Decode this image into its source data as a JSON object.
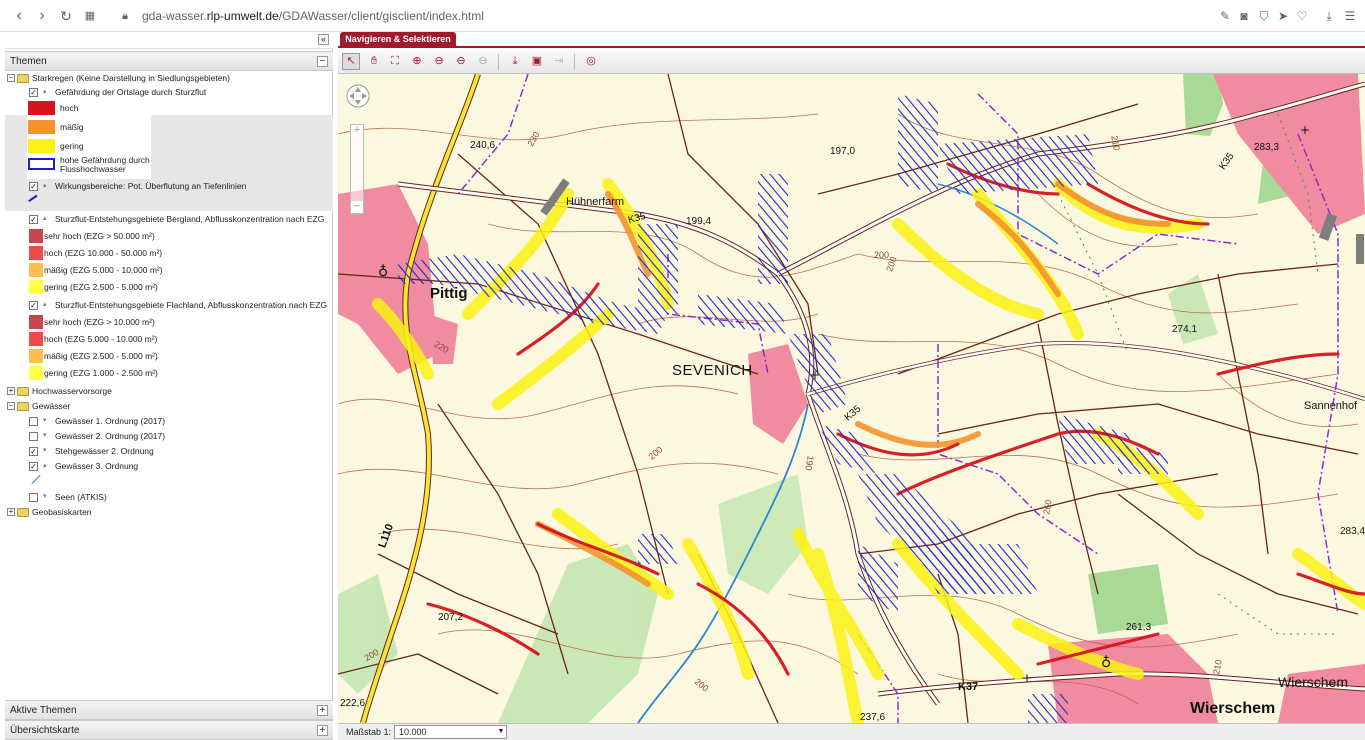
{
  "browser": {
    "url_prefix": "gda-wasser.",
    "url_host": "rlp-umwelt.de",
    "url_path": "/GDAWasser/client/gisclient/index.html"
  },
  "left_panel": {
    "themes_title": "Themen",
    "aktive_themen": "Aktive Themen",
    "uebersichtskarte": "Übersichtskarte",
    "tree": [
      {
        "label": "Starkregen (Keine Darstellung in Siedlungsgebieten)"
      },
      {
        "label": "Gefährdung der Ortslage durch Sturzflut"
      },
      {
        "label": "hoch",
        "color": "#d6141c"
      },
      {
        "label": "mäßig",
        "color": "#f5922e"
      },
      {
        "label": "gering",
        "color": "#fbf314"
      },
      {
        "label": "hohe Gefährdung durch",
        "label2": "Flusshochwasser",
        "color": "#1a1ad1"
      },
      {
        "label": "Wirkungsbereiche: Pot. Überflutung an Tiefenlinien"
      },
      {
        "label": "Sturzflut-Entstehungsgebiete Bergland, Abflusskonzentration nach EZG"
      },
      {
        "label": "sehr hoch (EZG > 50.000 m²)",
        "color": "#c9474a"
      },
      {
        "label": "hoch (EZG 10.000 - 50.000 m²)",
        "color": "#ee4b4b"
      },
      {
        "label": "mäßig (EZG 5.000 - 10.000 m²)",
        "color": "#ffbd4c"
      },
      {
        "label": "gering (EZG 2.500 - 5.000 m²)",
        "color": "#ffff44"
      },
      {
        "label": "Sturzflut-Entstehungsgebiete Flachland, Abflusskonzentration nach EZG"
      },
      {
        "label": "sehr hoch (EZG > 10.000 m²)",
        "color": "#c9474a"
      },
      {
        "label": "hoch (EZG 5.000 - 10.000 m²)",
        "color": "#ee4b4b"
      },
      {
        "label": "mäßig (EZG 2.500 - 5.000 m²)",
        "color": "#ffbd4c"
      },
      {
        "label": "gering (EZG 1.000 - 2.500 m²)",
        "color": "#ffff44"
      },
      {
        "label": "Hochwasservorsorge"
      },
      {
        "label": "Gewässer"
      },
      {
        "label": "Gewässer 1. Ordnung (2017)"
      },
      {
        "label": "Gewässer 2. Ordnung (2017)"
      },
      {
        "label": "Stehgewässer 2. Ordnung"
      },
      {
        "label": "Gewässer 3. Ordnung"
      },
      {
        "label": "Seen (ATKIS)"
      },
      {
        "label": "Geobasiskarten"
      }
    ]
  },
  "map": {
    "tab_label": "Navigieren & Selektieren",
    "labels": {
      "huehnerfarm": "Hühnerfarm",
      "k35_a": "K35",
      "k35_b": "K35",
      "k35_c": "K35",
      "k37": "K37",
      "l110": "L110",
      "sevenich": "SEVENICH",
      "pitting": "Pittig",
      "sannenhof": "Sannenhof",
      "wierschem": "Wierschem",
      "wierschem2": "Wierschem",
      "h240": "240,6",
      "h199": "199,4",
      "h197": "197,0",
      "h283a": "283,3",
      "h274": "274,1",
      "h283b": "283,4",
      "h261": "261,3",
      "h207": "207,2",
      "h222": "222,6",
      "h237": "237,6",
      "c230": "230",
      "c210": "210",
      "c200a": "200",
      "c220": "220",
      "c190": "190",
      "c200b": "200",
      "c260": "260",
      "c200c": "200",
      "c200d": "200",
      "c210b": "210",
      "c200e": "200"
    }
  },
  "statusbar": {
    "scale_label": "Maßstab 1:",
    "scale_value": "10.000"
  }
}
